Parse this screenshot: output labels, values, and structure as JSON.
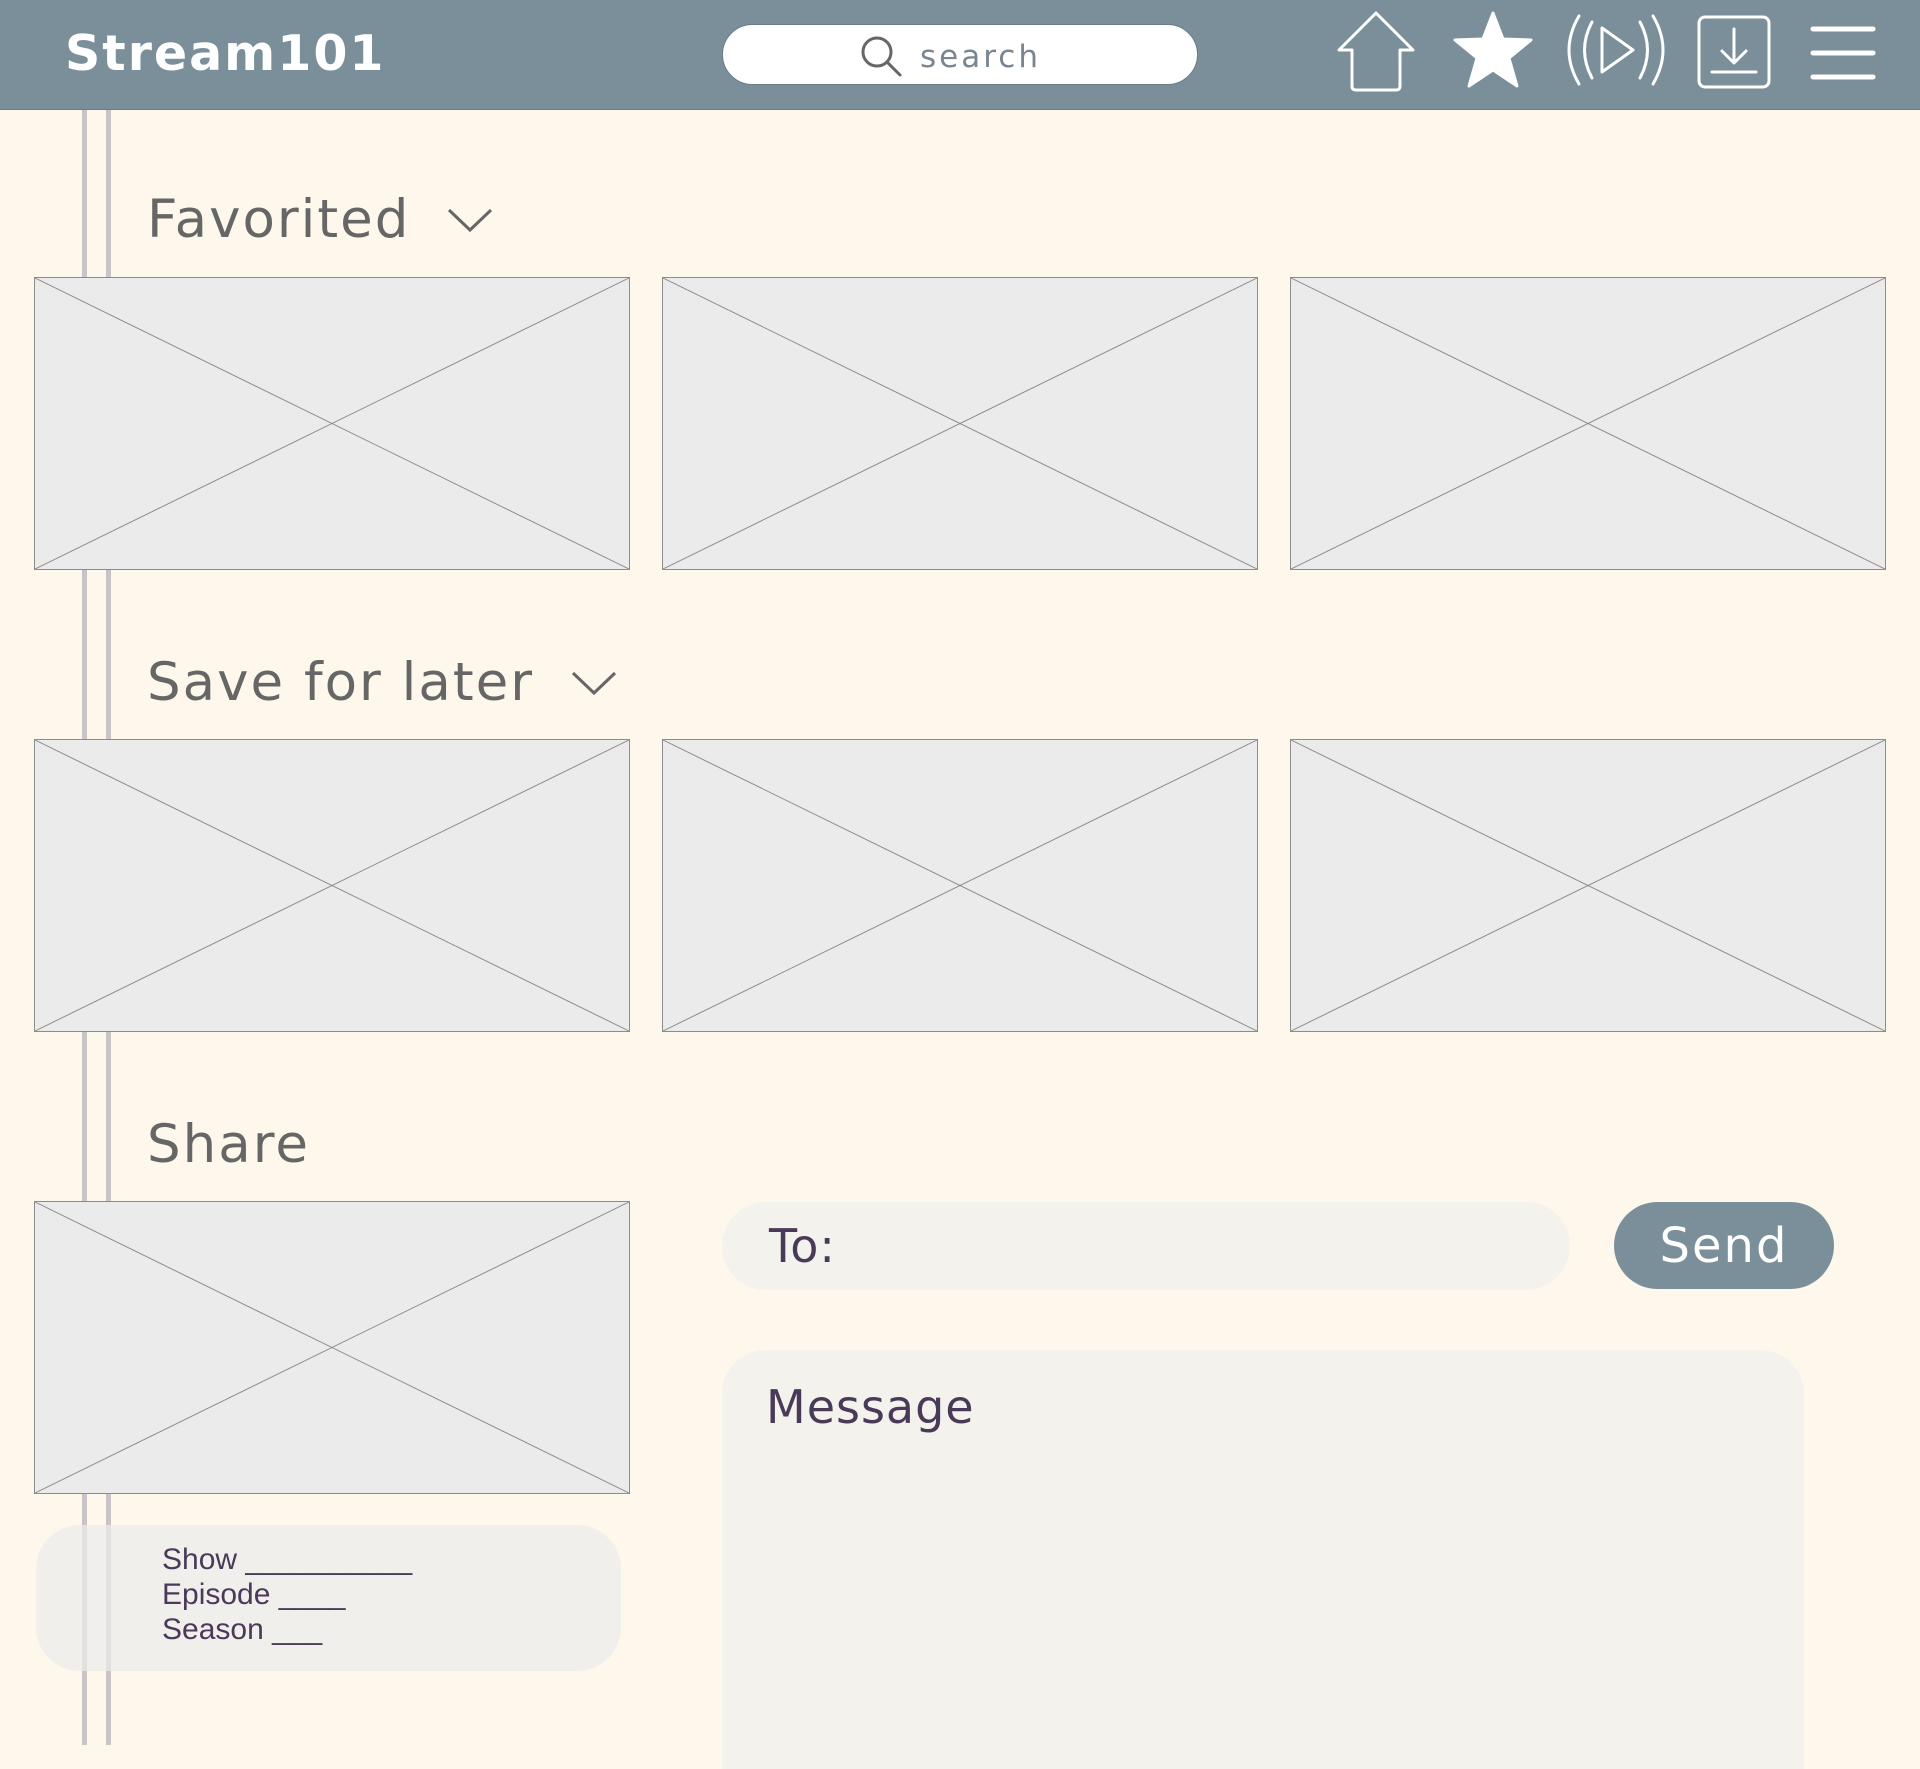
{
  "app": {
    "title": "Stream101"
  },
  "header": {
    "search_placeholder": "search",
    "icons": [
      "home-icon",
      "star-icon",
      "live-play-icon",
      "download-icon",
      "menu-icon"
    ]
  },
  "sections": {
    "favorited": {
      "title": "Favorited",
      "tiles": 3
    },
    "save_for_later": {
      "title": "Save for later",
      "tiles": 3
    },
    "share": {
      "title": "Share",
      "info": {
        "show": "Show __________",
        "episode": "Episode ____",
        "season": "Season ___"
      },
      "to_label": "To:",
      "send_label": "Send",
      "message_placeholder": "Message"
    }
  },
  "colors": {
    "header": "#7a8f9a",
    "background": "#fdf7ec",
    "field": "#f4f2ec",
    "text_accent": "#4a3a59",
    "placeholder_tile": "#ebebeb"
  }
}
